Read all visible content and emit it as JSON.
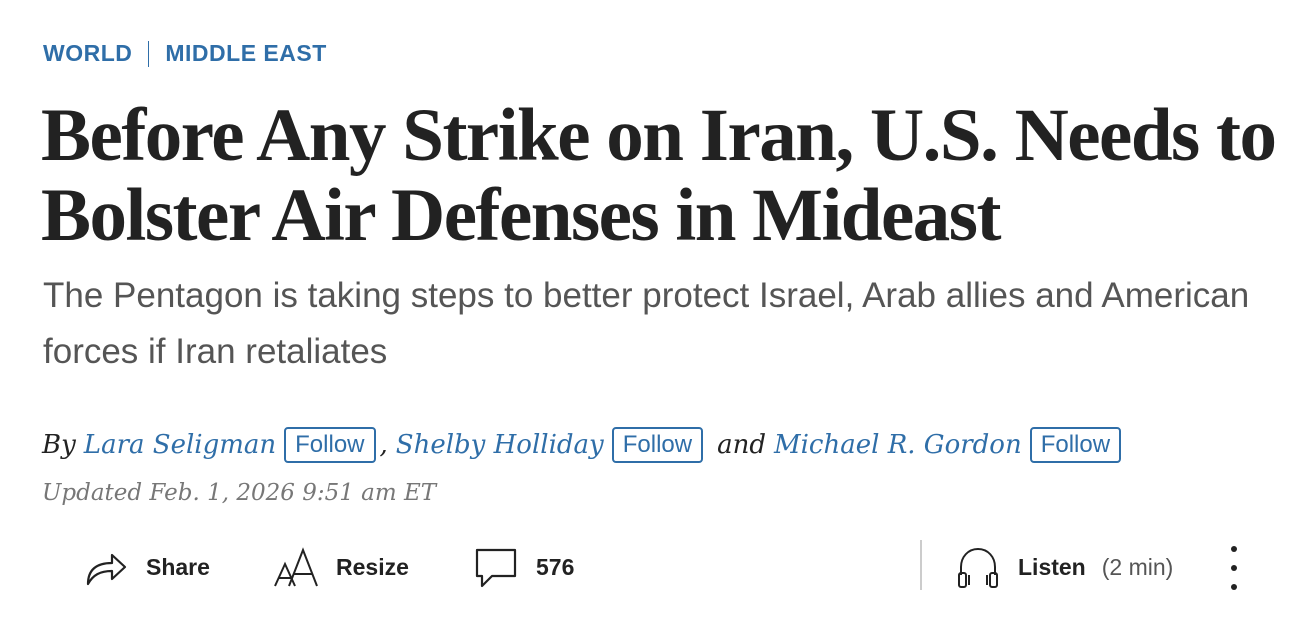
{
  "breadcrumbs": [
    {
      "label": "WORLD"
    },
    {
      "label": "MIDDLE EAST"
    }
  ],
  "headline": "Before Any Strike on Iran, U.S. Needs to Bolster Air Defenses in Mideast",
  "dek": "The Pentagon is taking steps to better protect Israel, Arab allies and American forces if Iran retaliates",
  "byline": {
    "prefix": "By",
    "authors": [
      {
        "name": "Lara Seligman",
        "follow_label": "Follow"
      },
      {
        "name": "Shelby Holliday",
        "follow_label": "Follow"
      },
      {
        "name": "Michael R. Gordon",
        "follow_label": "Follow"
      }
    ],
    "separator": ",",
    "conjunction": "and"
  },
  "updated": "Updated Feb. 1, 2026 9:51 am ET",
  "toolbar": {
    "share_label": "Share",
    "resize_label": "Resize",
    "comments_count": "576",
    "listen_label": "Listen",
    "listen_duration": "(2 min)"
  },
  "colors": {
    "accent": "#2f6ea8",
    "text": "#222222",
    "muted": "#555555"
  }
}
